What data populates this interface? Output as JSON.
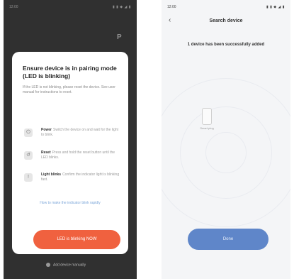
{
  "left": {
    "status": {
      "time": "12:00",
      "icons": "▮ ▮ ◆ ◢ ▮"
    },
    "background": {
      "corner_icon": "P"
    },
    "modal": {
      "title": "Ensure device is in pairing mode (LED is blinking)",
      "description": "If the LED is not blinking, please reset the device. See user manual for instructions to reset.",
      "steps": [
        {
          "icon": "power-icon",
          "title": "Power",
          "text": "Switch the device on and wait for the light to blink."
        },
        {
          "icon": "reset-icon",
          "title": "Reset",
          "text": "Press and hold the reset button until the LED blinks."
        },
        {
          "icon": "light-icon",
          "title": "Light blinks",
          "text": "Confirm the indicator light is blinking fast."
        }
      ],
      "link": "How to make the indicator blink rapidly",
      "confirm_button": "LED is blinking NOW"
    },
    "footer": "Add device manually"
  },
  "right": {
    "status": {
      "time": "12:00",
      "icons": "▮ ▮ ◆ ◢ ▮"
    },
    "header": {
      "back": "‹",
      "title": "Search device"
    },
    "subtitle": "1 device has been successfully added",
    "device_label": "Smart plug",
    "done_button": "Done"
  }
}
